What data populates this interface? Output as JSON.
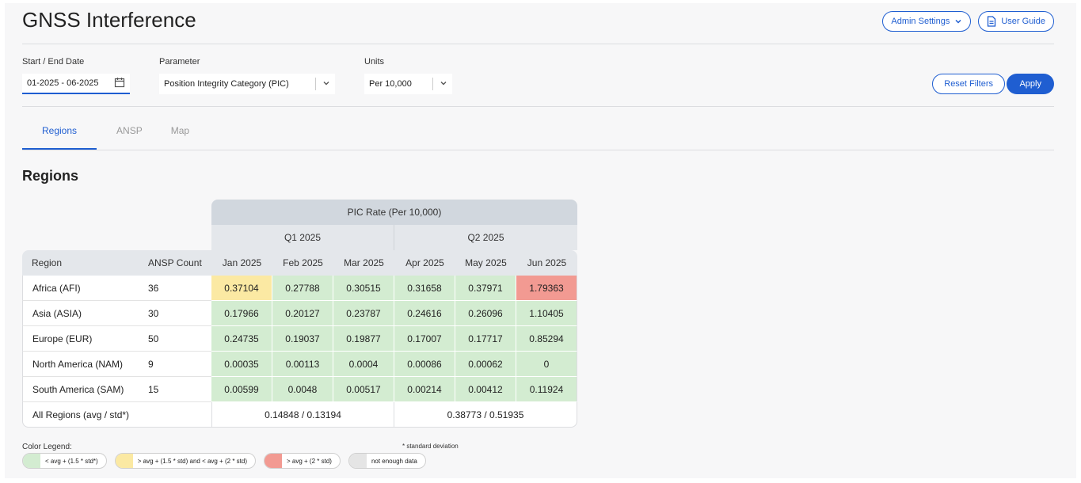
{
  "header": {
    "title": "GNSS Interference",
    "admin_settings_label": "Admin Settings",
    "user_guide_label": "User Guide"
  },
  "filters": {
    "date": {
      "label": "Start / End Date",
      "value": "01-2025 - 06-2025"
    },
    "parameter": {
      "label": "Parameter",
      "value": "Position Integrity Category (PIC)"
    },
    "units": {
      "label": "Units",
      "value": "Per 10,000"
    },
    "reset_label": "Reset Filters",
    "apply_label": "Apply"
  },
  "tabs": [
    {
      "label": "Regions",
      "active": true
    },
    {
      "label": "ANSP",
      "active": false
    },
    {
      "label": "Map",
      "active": false
    }
  ],
  "section_title": "Regions",
  "colors": {
    "accent": "#1f5ed1",
    "green": "#d3ecd1",
    "yellow": "#fbe9a3",
    "red": "#f29a92",
    "grey": "#e5e5e5"
  },
  "table": {
    "group_header": "PIC Rate (Per 10,000)",
    "quarters": [
      "Q1 2025",
      "Q2 2025"
    ],
    "region_header": "Region",
    "count_header": "ANSP Count",
    "months": [
      "Jan 2025",
      "Feb 2025",
      "Mar 2025",
      "Apr 2025",
      "May 2025",
      "Jun 2025"
    ],
    "rows": [
      {
        "region": "Africa (AFI)",
        "count": "36",
        "values": [
          "0.37104",
          "0.27788",
          "0.30515",
          "0.31658",
          "0.37971",
          "1.79363"
        ],
        "status": [
          "yellow",
          "green",
          "green",
          "green",
          "green",
          "red"
        ]
      },
      {
        "region": "Asia (ASIA)",
        "count": "30",
        "values": [
          "0.17966",
          "0.20127",
          "0.23787",
          "0.24616",
          "0.26096",
          "1.10405"
        ],
        "status": [
          "green",
          "green",
          "green",
          "green",
          "green",
          "green"
        ]
      },
      {
        "region": "Europe (EUR)",
        "count": "50",
        "values": [
          "0.24735",
          "0.19037",
          "0.19877",
          "0.17007",
          "0.17717",
          "0.85294"
        ],
        "status": [
          "green",
          "green",
          "green",
          "green",
          "green",
          "green"
        ]
      },
      {
        "region": "North America (NAM)",
        "count": "9",
        "values": [
          "0.00035",
          "0.00113",
          "0.0004",
          "0.00086",
          "0.00062",
          "0"
        ],
        "status": [
          "green",
          "green",
          "green",
          "green",
          "green",
          "green"
        ]
      },
      {
        "region": "South America (SAM)",
        "count": "15",
        "values": [
          "0.00599",
          "0.0048",
          "0.00517",
          "0.00214",
          "0.00412",
          "0.11924"
        ],
        "status": [
          "green",
          "green",
          "green",
          "green",
          "green",
          "green"
        ]
      }
    ],
    "summary": {
      "label": "All Regions (avg / std*)",
      "q1": "0.14848 / 0.13194",
      "q2": "0.38773 / 0.51935"
    }
  },
  "legend": {
    "title": "Color Legend:",
    "note": "* standard deviation",
    "items": [
      {
        "color": "green",
        "text": "< avg + (1.5 * std*)"
      },
      {
        "color": "yellow",
        "text": "> avg + (1.5 * std) and < avg + (2 * std)"
      },
      {
        "color": "red",
        "text": "> avg + (2 * std)"
      },
      {
        "color": "grey",
        "text": "not enough data"
      }
    ]
  }
}
